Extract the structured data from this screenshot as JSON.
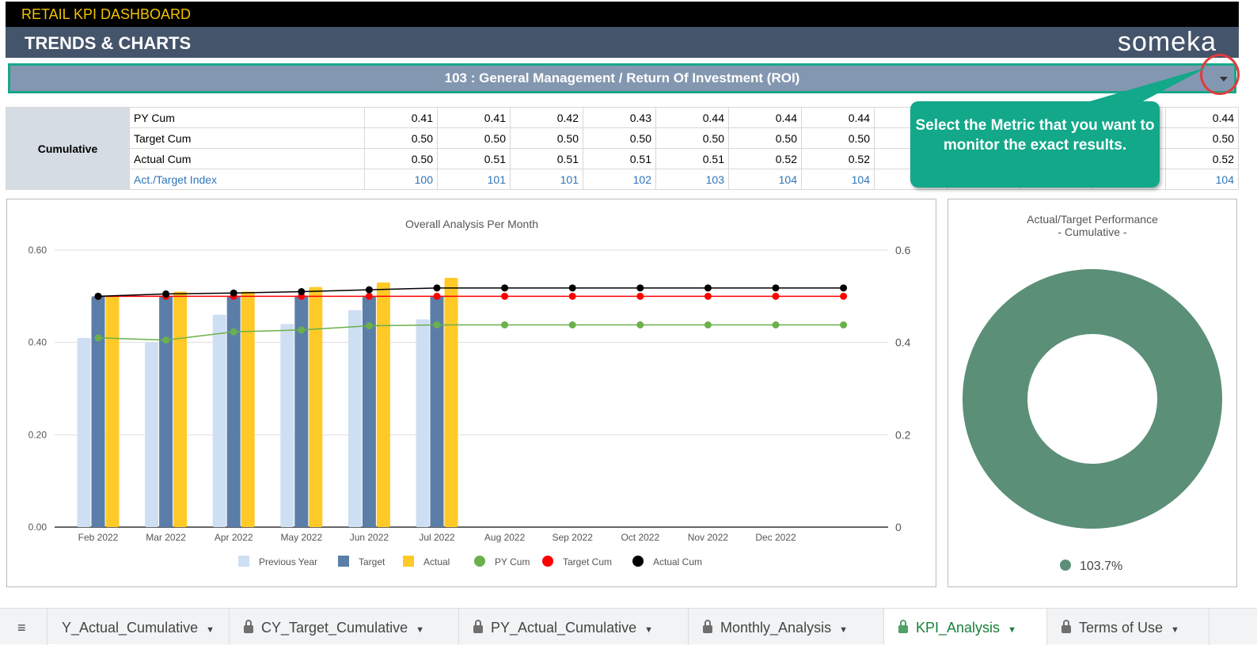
{
  "header": {
    "app_title": "RETAIL KPI DASHBOARD",
    "page_title": "TRENDS & CHARTS",
    "logo": "someka"
  },
  "selector": {
    "value": "103 : General Management / Return Of Investment (ROI)",
    "icon": "chevron-down-icon"
  },
  "callout": {
    "text": "Select the Metric that you want to monitor the exact results.",
    "color": "#12a889"
  },
  "table": {
    "group": "Cumulative",
    "rows": [
      {
        "label": "PY Cum",
        "values": [
          "0.41",
          "0.41",
          "0.42",
          "0.43",
          "0.44",
          "0.44",
          "0.44",
          "",
          "",
          "",
          "",
          "0.44"
        ]
      },
      {
        "label": "Target Cum",
        "values": [
          "0.50",
          "0.50",
          "0.50",
          "0.50",
          "0.50",
          "0.50",
          "0.50",
          "",
          "",
          "",
          "",
          "0.50"
        ]
      },
      {
        "label": "Actual Cum",
        "values": [
          "0.50",
          "0.51",
          "0.51",
          "0.51",
          "0.51",
          "0.52",
          "0.52",
          "",
          "",
          "",
          "",
          "0.52"
        ]
      },
      {
        "label": "Act./Target Index",
        "values": [
          "100",
          "101",
          "101",
          "102",
          "103",
          "104",
          "104",
          "",
          "",
          "",
          "",
          "104"
        ]
      }
    ]
  },
  "chart_data": [
    {
      "type": "bar+line",
      "title": "Overall Analysis Per Month",
      "categories": [
        "Feb 2022",
        "Mar 2022",
        "Apr 2022",
        "May 2022",
        "Jun 2022",
        "Jul 2022",
        "Aug 2022",
        "Sep 2022",
        "Oct 2022",
        "Nov 2022",
        "Dec 2022",
        ""
      ],
      "ylim": [
        0,
        0.6
      ],
      "yticks_left": [
        "0.00",
        "0.20",
        "0.40",
        "0.60"
      ],
      "yticks_right": [
        "0",
        "0.2",
        "0.4",
        "0.6"
      ],
      "grid": true,
      "legend_placement": "bottom",
      "series": [
        {
          "name": "Previous Year",
          "kind": "bar",
          "color": "#cfdff3",
          "values": [
            0.41,
            0.4,
            0.46,
            0.44,
            0.47,
            0.45,
            null,
            null,
            null,
            null,
            null,
            null
          ]
        },
        {
          "name": "Target",
          "kind": "bar",
          "color": "#5b7ea8",
          "values": [
            0.5,
            0.5,
            0.5,
            0.5,
            0.5,
            0.5,
            null,
            null,
            null,
            null,
            null,
            null
          ]
        },
        {
          "name": "Actual",
          "kind": "bar",
          "color": "#ffca28",
          "values": [
            0.5,
            0.51,
            0.51,
            0.52,
            0.53,
            0.54,
            null,
            null,
            null,
            null,
            null,
            null
          ]
        },
        {
          "name": "PY Cum",
          "kind": "line",
          "color": "#6ab04c",
          "values": [
            0.41,
            0.405,
            0.423,
            0.427,
            0.436,
            0.438,
            0.438,
            0.438,
            0.438,
            0.438,
            0.438,
            0.438
          ]
        },
        {
          "name": "Target Cum",
          "kind": "line",
          "color": "#ff0000",
          "values": [
            0.5,
            0.5,
            0.5,
            0.5,
            0.5,
            0.5,
            0.5,
            0.5,
            0.5,
            0.5,
            0.5,
            0.5
          ]
        },
        {
          "name": "Actual Cum",
          "kind": "line",
          "color": "#000000",
          "values": [
            0.5,
            0.505,
            0.507,
            0.51,
            0.514,
            0.518,
            0.518,
            0.518,
            0.518,
            0.518,
            0.518,
            0.518
          ]
        }
      ]
    },
    {
      "type": "pie",
      "title": "Actual/Target Performance",
      "subtitle": "- Cumulative -",
      "values": [
        103.7
      ],
      "labels": [
        "103.7%"
      ],
      "color": "#5b8f78"
    }
  ],
  "tabs": [
    {
      "label": "Y_Actual_Cumulative",
      "locked": false
    },
    {
      "label": "CY_Target_Cumulative",
      "locked": true
    },
    {
      "label": "PY_Actual_Cumulative",
      "locked": true
    },
    {
      "label": "Monthly_Analysis",
      "locked": true
    },
    {
      "label": "KPI_Analysis",
      "locked": true,
      "active": true
    },
    {
      "label": "Terms of Use",
      "locked": true
    }
  ]
}
